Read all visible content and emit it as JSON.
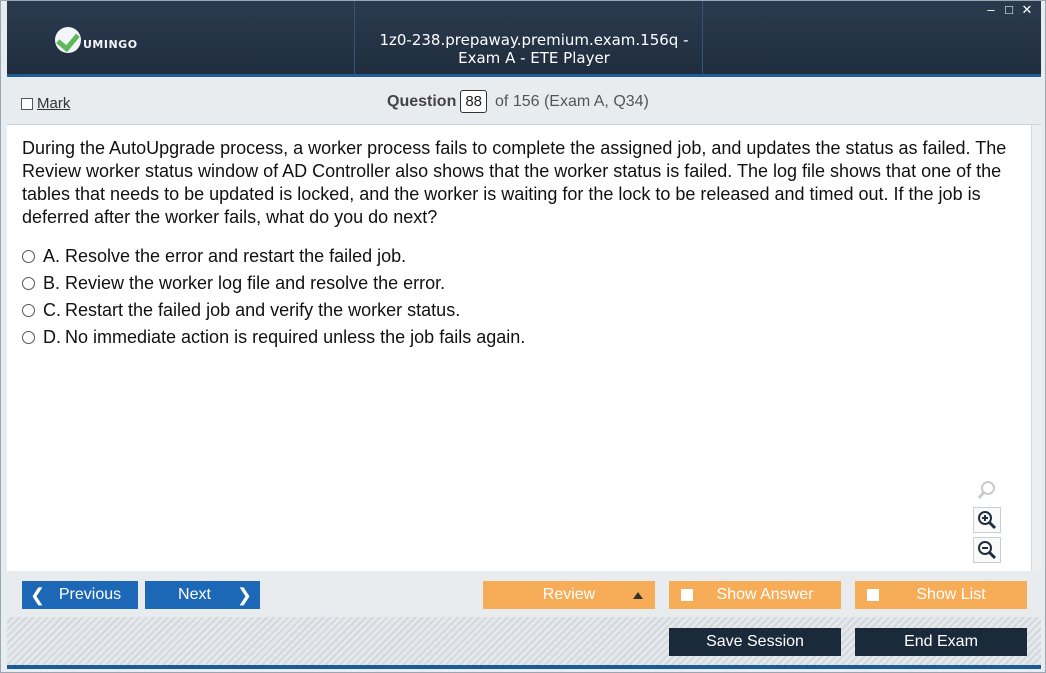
{
  "app": {
    "logo_text": "UMINGO",
    "title": "1z0-238.prepaway.premium.exam.156q - Exam A - ETE Player",
    "window_controls": [
      "–",
      "□",
      "✕"
    ]
  },
  "header": {
    "mark_label": "Mark",
    "question_label": "Question",
    "question_number": "88",
    "question_of": "of 156 (Exam A, Q34)"
  },
  "question": {
    "text": "During the AutoUpgrade process, a worker process fails to complete the assigned job, and updates the status as failed. The Review worker status window of AD Controller also shows that the worker status is failed. The log file shows that one of the tables that needs to be updated is locked, and the worker is waiting for the lock to be released and timed out. If the job is deferred after the worker fails, what do you do next?",
    "options": [
      {
        "letter": "A.",
        "text": "Resolve the error and restart the failed job."
      },
      {
        "letter": "B.",
        "text": "Review the worker log file and resolve the error."
      },
      {
        "letter": "C.",
        "text": "Restart the failed job and verify the worker status."
      },
      {
        "letter": "D.",
        "text": "No immediate action is required unless the job fails again."
      }
    ]
  },
  "nav": {
    "previous": "Previous",
    "next": "Next",
    "review": "Review",
    "show_answer": "Show Answer",
    "show_list": "Show List",
    "save_session": "Save Session",
    "end_exam": "End Exam"
  },
  "colors": {
    "title_bar": "#1f2d3e",
    "accent_blue": "#1c68b6",
    "orange": "#f7ad58",
    "dark_button": "#1b2a3a",
    "logo_check": "#5db85c"
  }
}
